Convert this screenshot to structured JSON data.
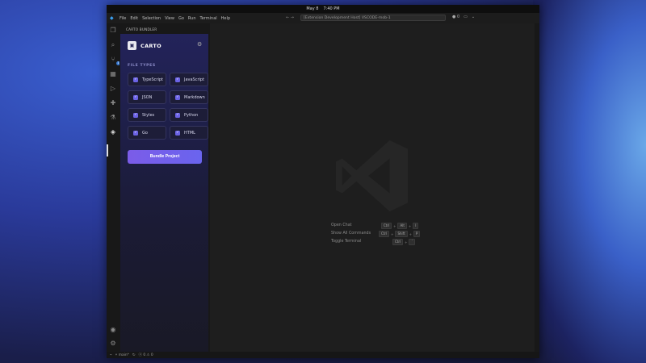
{
  "system_bar": {
    "date": "May 8",
    "time": "7:40 PM"
  },
  "titlebar": {
    "menus": [
      "File",
      "Edit",
      "Selection",
      "View",
      "Go",
      "Run",
      "Terminal",
      "Help"
    ],
    "command_center": "[Extension Development Host] VSCODE-mob-1",
    "nav_arrows": "← →",
    "ports_count": "0"
  },
  "sidebar": {
    "header": "CARTO BUNDLER",
    "brand": "CARTO",
    "section_label": "FILE TYPES",
    "file_types": [
      {
        "label": "TypeScript",
        "checked": true
      },
      {
        "label": "JavaScript",
        "checked": true
      },
      {
        "label": "JSON",
        "checked": true
      },
      {
        "label": "Markdown",
        "checked": true
      },
      {
        "label": "Styles",
        "checked": true
      },
      {
        "label": "Python",
        "checked": true
      },
      {
        "label": "Go",
        "checked": true
      },
      {
        "label": "HTML",
        "checked": true
      }
    ],
    "bundle_button": "Bundle Project"
  },
  "activitybar": {
    "scm_badge": "1"
  },
  "editor": {
    "shortcuts": [
      {
        "label": "Open Chat",
        "keys": [
          "Ctrl",
          "Alt",
          "I"
        ]
      },
      {
        "label": "Show All Commands",
        "keys": [
          "Ctrl",
          "Shift",
          "P"
        ]
      },
      {
        "label": "Toggle Terminal",
        "keys": [
          "Ctrl",
          "`"
        ]
      }
    ]
  },
  "statusbar": {
    "branch": "main*",
    "errors": "0",
    "warnings": "0"
  },
  "colors": {
    "accent": "#6c63e6",
    "panel_top": "#23235a",
    "vscode_blue": "#3aa0f0"
  }
}
